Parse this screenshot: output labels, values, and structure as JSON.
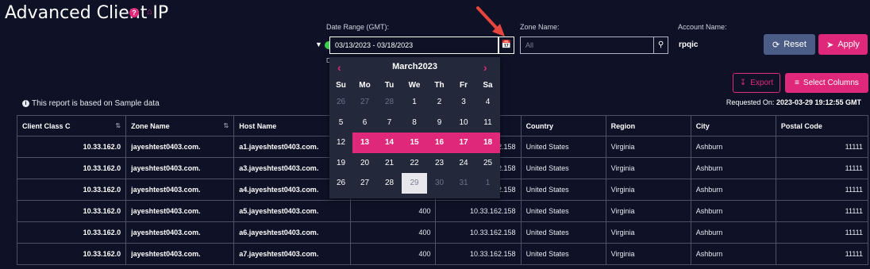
{
  "header": {
    "title": "Advanced Client IP",
    "help_icon": "question-circle-icon",
    "home_icon": "home-icon"
  },
  "filters": {
    "date_label": "Date Range (GMT):",
    "date_value": "03/13/2023 - 03/18/2023",
    "zone_label": "Zone Name:",
    "zone_placeholder": "All",
    "account_label": "Account Name:",
    "account_value": "rpqic",
    "under_label": "D"
  },
  "buttons": {
    "reset": "Reset",
    "apply": "Apply",
    "export": "Export",
    "select_columns": "Select Columns"
  },
  "info": "This report is based on Sample data",
  "requested": {
    "label": "Requested On:",
    "value": "2023-03-29 19:12:55 GMT"
  },
  "calendar": {
    "month": "March2023",
    "days_of_week": [
      "Su",
      "Mo",
      "Tu",
      "We",
      "Th",
      "Fr",
      "Sa"
    ],
    "weeks": [
      [
        "26",
        "27",
        "28",
        "1",
        "2",
        "3",
        "4"
      ],
      [
        "5",
        "6",
        "7",
        "8",
        "9",
        "10",
        "11"
      ],
      [
        "12",
        "13",
        "14",
        "15",
        "16",
        "17",
        "18"
      ],
      [
        "19",
        "20",
        "21",
        "22",
        "23",
        "24",
        "25"
      ],
      [
        "26",
        "27",
        "28",
        "29",
        "30",
        "31",
        "1"
      ]
    ],
    "selected_start": 13,
    "selected_end": 18,
    "today": 29
  },
  "table": {
    "columns": [
      "Client Class C",
      "Zone Name",
      "Host Name",
      "",
      "",
      "Country",
      "Region",
      "City",
      "Postal Code"
    ],
    "rows": [
      [
        "10.33.162.0",
        "jayeshtest0403.com.",
        "a1.jayeshtest0403.com.",
        "",
        "10.33.162.158",
        "United States",
        "Virginia",
        "Ashburn",
        "11111"
      ],
      [
        "10.33.162.0",
        "jayeshtest0403.com.",
        "a3.jayeshtest0403.com.",
        "",
        "10.33.162.158",
        "United States",
        "Virginia",
        "Ashburn",
        "11111"
      ],
      [
        "10.33.162.0",
        "jayeshtest0403.com.",
        "a4.jayeshtest0403.com.",
        "",
        "10.33.162.158",
        "United States",
        "Virginia",
        "Ashburn",
        "11111"
      ],
      [
        "10.33.162.0",
        "jayeshtest0403.com.",
        "a5.jayeshtest0403.com.",
        "400",
        "10.33.162.158",
        "United States",
        "Virginia",
        "Ashburn",
        "11111"
      ],
      [
        "10.33.162.0",
        "jayeshtest0403.com.",
        "a6.jayeshtest0403.com.",
        "400",
        "10.33.162.158",
        "United States",
        "Virginia",
        "Ashburn",
        "11111"
      ],
      [
        "10.33.162.0",
        "jayeshtest0403.com.",
        "a7.jayeshtest0403.com.",
        "400",
        "10.33.162.158",
        "United States",
        "Virginia",
        "Ashburn",
        "11111"
      ]
    ]
  },
  "colors": {
    "accent": "#e0287b",
    "background": "#0f1226",
    "reset": "#4b5d86",
    "annotation_arrow": "#e8453c"
  }
}
